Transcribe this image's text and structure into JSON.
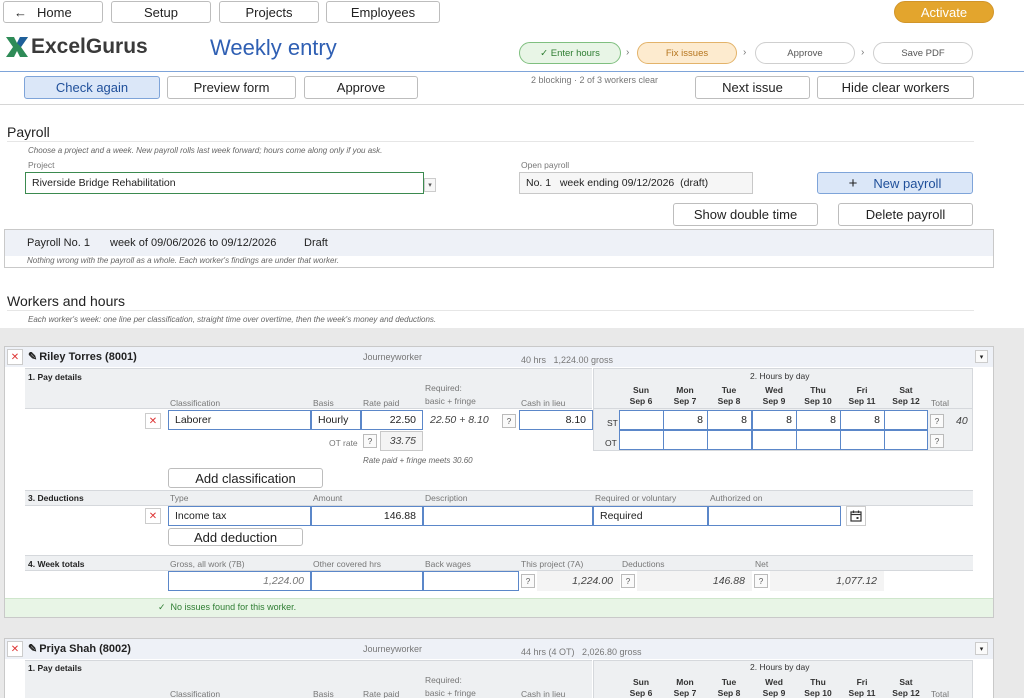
{
  "nav": {
    "home": "Home",
    "setup": "Setup",
    "projects": "Projects",
    "employees": "Employees",
    "activate": "Activate"
  },
  "brand": {
    "logo_text": "ExcelGurus",
    "page_title": "Weekly entry"
  },
  "steps": [
    {
      "label": "✓ Enter hours"
    },
    {
      "label": "Fix issues"
    },
    {
      "label": "Approve"
    },
    {
      "label": "Save PDF"
    }
  ],
  "toolbar": {
    "check_again": "Check again",
    "preview_form": "Preview form",
    "approve": "Approve",
    "status": "2 blocking · 2 of 3 workers clear",
    "next_issue": "Next issue",
    "hide_clear": "Hide clear workers"
  },
  "payroll": {
    "title": "Payroll",
    "hint": "Choose a project and a week. New payroll rolls last week forward; hours come along only if you ask.",
    "project_label": "Project",
    "project_value": "Riverside Bridge Rehabilitation",
    "open_label": "Open payroll",
    "open_value": "No. 1   week ending 09/12/2026  (draft)",
    "new_payroll": "New payroll",
    "show_double": "Show double time",
    "delete_payroll": "Delete payroll",
    "summary_no": "Payroll No. 1",
    "summary_week": "week of 09/06/2026 to 09/12/2026",
    "summary_status": "Draft",
    "summary_note": "Nothing wrong with the payroll as a whole. Each worker's findings are under that worker."
  },
  "workers": {
    "title": "Workers and hours",
    "hint": "Each worker's week: one line per classification, straight time over overtime, then the week's money and deductions."
  },
  "w1": {
    "name": "Riley Torres (8001)",
    "role": "Journeyworker",
    "hours": "40 hrs   1,224.00 gross",
    "pay_details": "1. Pay details",
    "hours_by_day": "2. Hours by day",
    "col_class": "Classification",
    "col_basis": "Basis",
    "col_rate": "Rate paid",
    "col_required": "Required:\nbasic + fringe",
    "col_required_a": "Required:",
    "col_required_b": "basic + fringe",
    "col_cash": "Cash in lieu",
    "days": [
      {
        "d": "Sun",
        "dt": "Sep 6"
      },
      {
        "d": "Mon",
        "dt": "Sep 7"
      },
      {
        "d": "Tue",
        "dt": "Sep 8"
      },
      {
        "d": "Wed",
        "dt": "Sep 9"
      },
      {
        "d": "Thu",
        "dt": "Sep 10"
      },
      {
        "d": "Fri",
        "dt": "Sep 11"
      },
      {
        "d": "Sat",
        "dt": "Sep 12"
      }
    ],
    "total_label": "Total",
    "classification": "Laborer",
    "basis": "Hourly",
    "rate": "22.50",
    "required": "22.50 + 8.10",
    "cash": "8.10",
    "st_label": "ST",
    "ot_label": "OT",
    "st_hours": [
      "",
      "8",
      "8",
      "8",
      "8",
      "8",
      ""
    ],
    "st_total": "40",
    "ot_rate_label": "OT rate",
    "ot_rate": "33.75",
    "rate_note": "Rate paid + fringe meets 30.60",
    "add_class": "Add classification",
    "deductions": "3. Deductions",
    "col_type": "Type",
    "col_amount": "Amount",
    "col_desc": "Description",
    "col_req_vol": "Required or voluntary",
    "col_auth": "Authorized on",
    "ded_type": "Income tax",
    "ded_amount": "146.88",
    "ded_req": "Required",
    "add_deduction": "Add deduction",
    "week_totals": "4. Week totals",
    "col_gross": "Gross, all work (7B)",
    "col_other": "Other covered hrs",
    "col_back": "Back wages",
    "col_project": "This project (7A)",
    "col_deductions": "Deductions",
    "col_net": "Net",
    "gross": "1,224.00",
    "project": "1,224.00",
    "deductions_total": "146.88",
    "net": "1,077.12",
    "ok_msg": "✓  No issues found for this worker."
  },
  "w2": {
    "name": "Priya Shah (8002)",
    "role": "Journeyworker",
    "hours": "44 hrs (4 OT)   2,026.80 gross",
    "pay_details": "1. Pay details",
    "hours_by_day": "2. Hours by day",
    "col_class": "Classification",
    "col_basis": "Basis",
    "col_rate": "Rate paid",
    "col_required_a": "Required:",
    "col_required_b": "basic + fringe",
    "col_cash": "Cash in lieu",
    "total_label": "Total"
  },
  "colors": {
    "accent": "#e3a52d",
    "link_blue": "#2f5fb3",
    "brand_green": "#2e8b57",
    "field_border": "#5b87c9"
  }
}
